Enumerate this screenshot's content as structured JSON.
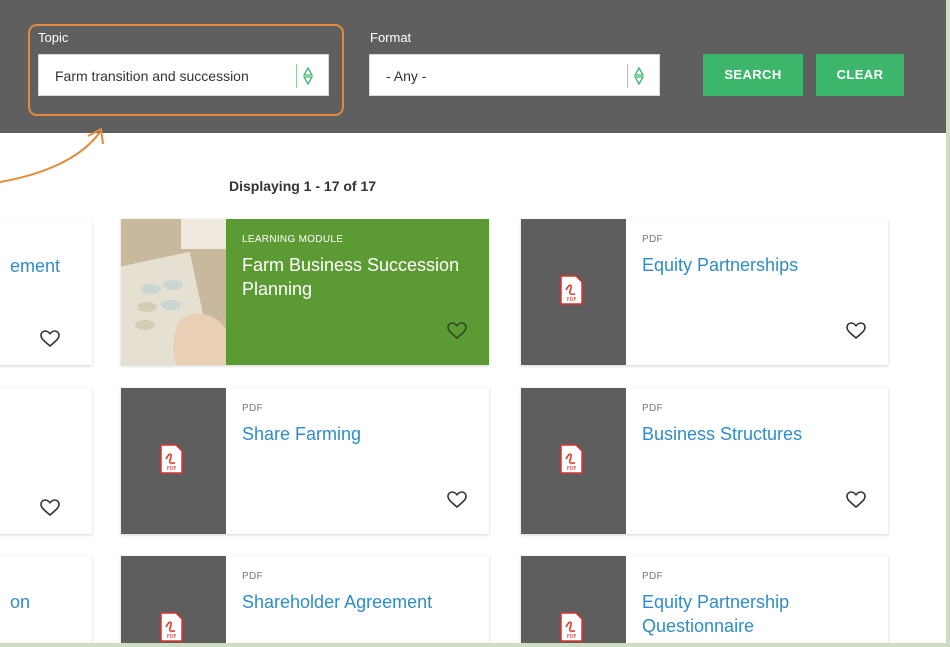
{
  "filters": {
    "topic": {
      "label": "Topic",
      "value": "Farm transition and succession"
    },
    "format": {
      "label": "Format",
      "value": "- Any -"
    },
    "search_label": "SEARCH",
    "clear_label": "CLEAR"
  },
  "results": {
    "count_text": "Displaying 1 - 17 of 17",
    "partial_cards": [
      {
        "title_fragment": "ement"
      },
      {
        "title_fragment": ""
      },
      {
        "title_fragment": "on"
      }
    ],
    "cards": [
      {
        "type": "LEARNING MODULE",
        "title": "Farm Business Succession Planning"
      },
      {
        "type": "PDF",
        "title": "Equity Partnerships"
      },
      {
        "type": "PDF",
        "title": "Share Farming"
      },
      {
        "type": "PDF",
        "title": "Business Structures"
      },
      {
        "type": "PDF",
        "title": "Shareholder Agreement"
      },
      {
        "type": "PDF",
        "title": "Equity Partnership Questionnaire"
      }
    ]
  },
  "colors": {
    "filterbar": "#5f5f5f",
    "accent_green": "#3cb66a",
    "feature_green": "#5c9a34",
    "link_blue": "#2e8dc8",
    "highlight_orange": "#e58a3a"
  }
}
